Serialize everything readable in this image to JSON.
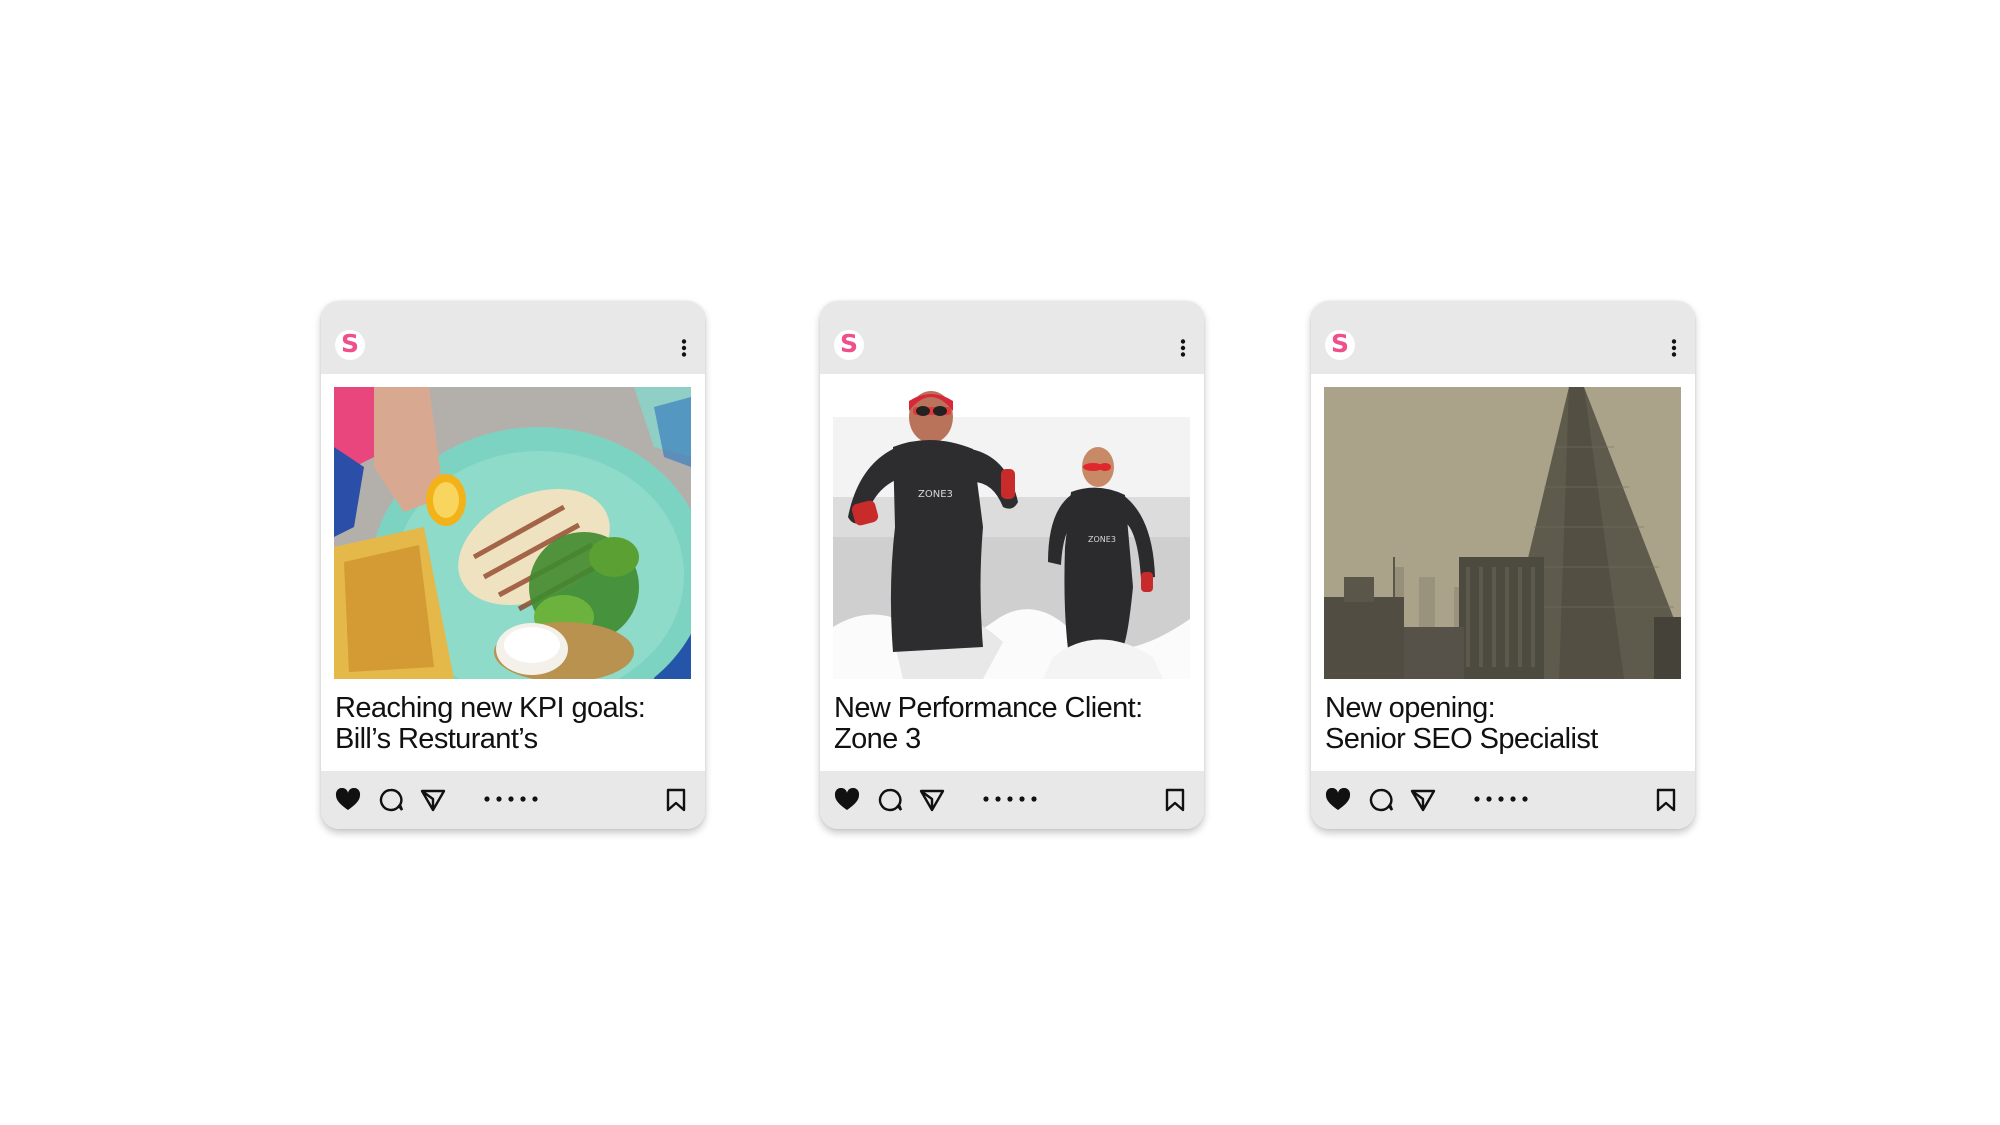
{
  "brand": {
    "logo_letter": "S",
    "accent_color": "#ef4f8b"
  },
  "cards": [
    {
      "caption_line1": "Reaching new KPI goals:",
      "caption_line2": "Bill’s Resturant’s",
      "image": "grilled chicken salad plate with flatbread and lemon"
    },
    {
      "caption_line1": "New Performance Client:",
      "caption_line2": "Zone 3",
      "image": "two swimmers in wetsuits running out of the sea",
      "image_text": "ZONE3"
    },
    {
      "caption_line1": "New opening:",
      "caption_line2": "Senior SEO Specialist",
      "image": "hazy city skyline with tall glass tower"
    }
  ],
  "icons": [
    "more-vertical-icon",
    "heart-icon",
    "comment-icon",
    "send-icon",
    "carousel-dots-icon",
    "bookmark-icon"
  ]
}
